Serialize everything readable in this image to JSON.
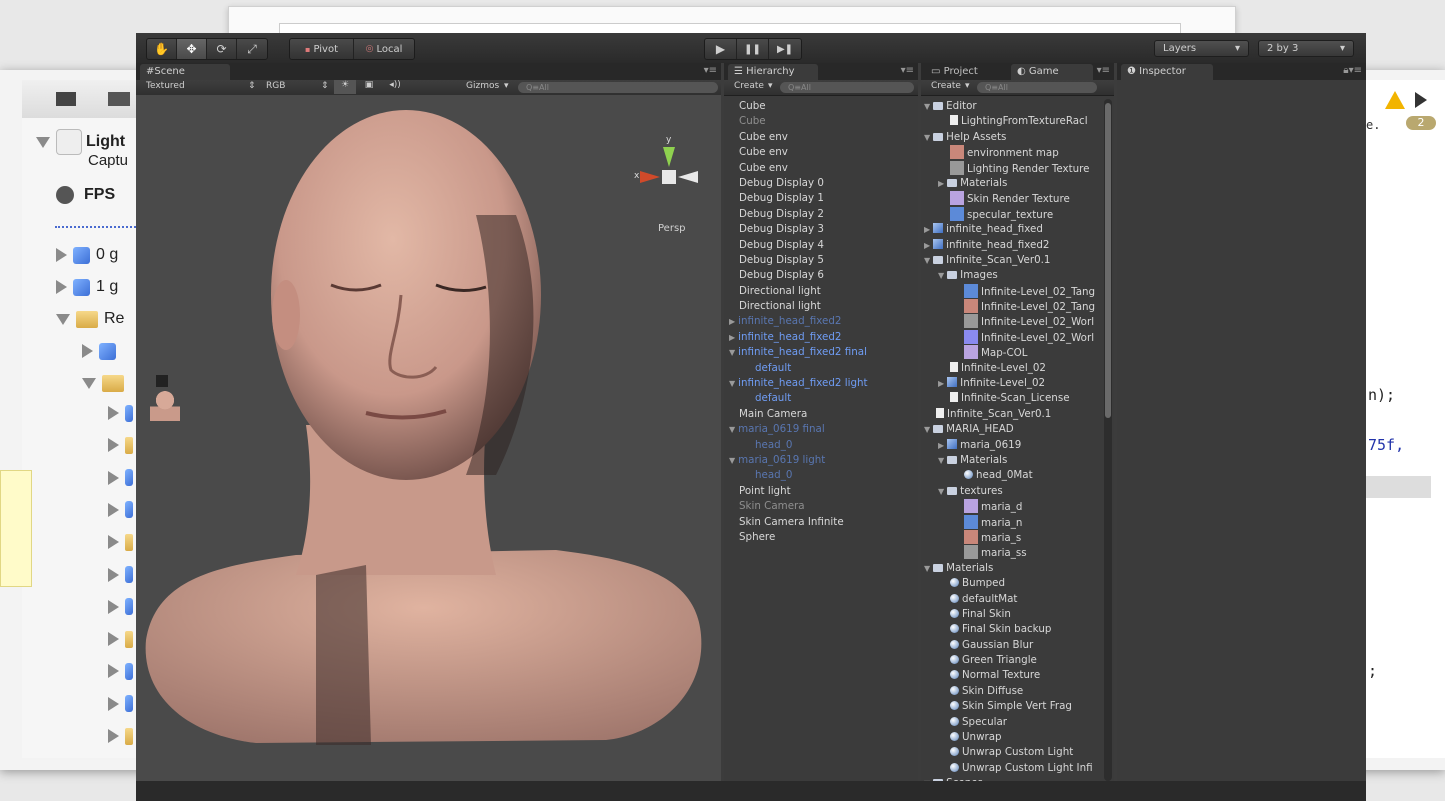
{
  "background_window": {
    "tree": [
      {
        "label": "Light",
        "sub": "Captu"
      },
      {
        "label": "FPS"
      },
      {
        "label": "0 g"
      },
      {
        "label": "1 g"
      },
      {
        "label": "Re"
      }
    ],
    "code_fragments": [
      "n);",
      "75f,",
      ";"
    ],
    "badge": "2",
    "dot": "e."
  },
  "toolbar": {
    "tools": [
      "hand-tool",
      "move-tool",
      "rotate-tool",
      "scale-tool"
    ],
    "pivot_label": "Pivot",
    "local_label": "Local",
    "play": "▶",
    "pause": "❚❚",
    "step": "▶❚",
    "layers_label": "Layers",
    "layout_label": "2 by 3"
  },
  "scene": {
    "tab": "Scene",
    "render_mode": "Textured",
    "channel": "RGB",
    "gizmos": "Gizmos",
    "search_placeholder": "Q≡All",
    "persp": "Persp",
    "gizmo_y": "y",
    "gizmo_x": "x"
  },
  "hierarchy": {
    "tab": "Hierarchy",
    "create": "Create",
    "search_placeholder": "Q≡All",
    "items": [
      {
        "label": "Cube",
        "style": "normal",
        "indent": 0,
        "arrow": ""
      },
      {
        "label": "Cube",
        "style": "dim",
        "indent": 0,
        "arrow": ""
      },
      {
        "label": "Cube env",
        "style": "normal",
        "indent": 0,
        "arrow": ""
      },
      {
        "label": "Cube env",
        "style": "normal",
        "indent": 0,
        "arrow": ""
      },
      {
        "label": "Cube env",
        "style": "normal",
        "indent": 0,
        "arrow": ""
      },
      {
        "label": "Debug Display 0",
        "style": "normal",
        "indent": 0,
        "arrow": ""
      },
      {
        "label": "Debug Display 1",
        "style": "normal",
        "indent": 0,
        "arrow": ""
      },
      {
        "label": "Debug Display 2",
        "style": "normal",
        "indent": 0,
        "arrow": ""
      },
      {
        "label": "Debug Display 3",
        "style": "normal",
        "indent": 0,
        "arrow": ""
      },
      {
        "label": "Debug Display 4",
        "style": "normal",
        "indent": 0,
        "arrow": ""
      },
      {
        "label": "Debug Display 5",
        "style": "normal",
        "indent": 0,
        "arrow": ""
      },
      {
        "label": "Debug Display 6",
        "style": "normal",
        "indent": 0,
        "arrow": ""
      },
      {
        "label": "Directional light",
        "style": "normal",
        "indent": 0,
        "arrow": ""
      },
      {
        "label": "Directional light",
        "style": "normal",
        "indent": 0,
        "arrow": ""
      },
      {
        "label": "infinite_head_fixed2",
        "style": "bluedim",
        "indent": 0,
        "arrow": "▶"
      },
      {
        "label": "infinite_head_fixed2",
        "style": "blue",
        "indent": 0,
        "arrow": "▶"
      },
      {
        "label": "infinite_head_fixed2 final",
        "style": "blue",
        "indent": 0,
        "arrow": "▼"
      },
      {
        "label": "default",
        "style": "blue",
        "indent": 1,
        "arrow": ""
      },
      {
        "label": "infinite_head_fixed2 light",
        "style": "blue",
        "indent": 0,
        "arrow": "▼"
      },
      {
        "label": "default",
        "style": "blue",
        "indent": 1,
        "arrow": ""
      },
      {
        "label": "Main Camera",
        "style": "normal",
        "indent": 0,
        "arrow": ""
      },
      {
        "label": "maria_0619 final",
        "style": "bluedim",
        "indent": 0,
        "arrow": "▼"
      },
      {
        "label": "head_0",
        "style": "bluedim",
        "indent": 1,
        "arrow": ""
      },
      {
        "label": "maria_0619 light",
        "style": "bluedim",
        "indent": 0,
        "arrow": "▼"
      },
      {
        "label": "head_0",
        "style": "bluedim",
        "indent": 1,
        "arrow": ""
      },
      {
        "label": "Point light",
        "style": "normal",
        "indent": 0,
        "arrow": ""
      },
      {
        "label": "Skin Camera",
        "style": "dim",
        "indent": 0,
        "arrow": ""
      },
      {
        "label": "Skin Camera Infinite",
        "style": "normal",
        "indent": 0,
        "arrow": ""
      },
      {
        "label": "Sphere",
        "style": "normal",
        "indent": 0,
        "arrow": ""
      }
    ]
  },
  "project": {
    "tab_project": "Project",
    "tab_game": "Game",
    "create": "Create",
    "search_placeholder": "Q≡All",
    "items": [
      {
        "label": "Editor",
        "indent": 0,
        "arrow": "▼",
        "icon": "folder"
      },
      {
        "label": "LightingFromTextureRacl",
        "indent": 1,
        "arrow": "",
        "icon": "doc"
      },
      {
        "label": "Help Assets",
        "indent": 0,
        "arrow": "▼",
        "icon": "folder"
      },
      {
        "label": "environment map",
        "indent": 1,
        "arrow": "",
        "icon": "tex"
      },
      {
        "label": "Lighting Render Texture",
        "indent": 1,
        "arrow": "",
        "icon": "tex"
      },
      {
        "label": "Materials",
        "indent": 1,
        "arrow": "▶",
        "icon": "folder"
      },
      {
        "label": "Skin Render Texture",
        "indent": 1,
        "arrow": "",
        "icon": "tex"
      },
      {
        "label": "specular_texture",
        "indent": 1,
        "arrow": "",
        "icon": "tex"
      },
      {
        "label": "infinite_head_fixed",
        "indent": 0,
        "arrow": "▶",
        "icon": "prefab"
      },
      {
        "label": "infinite_head_fixed2",
        "indent": 0,
        "arrow": "▶",
        "icon": "prefab"
      },
      {
        "label": "Infinite_Scan_Ver0.1",
        "indent": 0,
        "arrow": "▼",
        "icon": "folder"
      },
      {
        "label": "Images",
        "indent": 1,
        "arrow": "▼",
        "icon": "folder"
      },
      {
        "label": "Infinite-Level_02_Tang",
        "indent": 2,
        "arrow": "",
        "icon": "tex"
      },
      {
        "label": "Infinite-Level_02_Tang",
        "indent": 2,
        "arrow": "",
        "icon": "tex"
      },
      {
        "label": "Infinite-Level_02_Worl",
        "indent": 2,
        "arrow": "",
        "icon": "tex"
      },
      {
        "label": "Infinite-Level_02_Worl",
        "indent": 2,
        "arrow": "",
        "icon": "tex"
      },
      {
        "label": "Map-COL",
        "indent": 2,
        "arrow": "",
        "icon": "tex"
      },
      {
        "label": "Infinite-Level_02",
        "indent": 1,
        "arrow": "",
        "icon": "doc"
      },
      {
        "label": "Infinite-Level_02",
        "indent": 1,
        "arrow": "▶",
        "icon": "prefab"
      },
      {
        "label": "Infinite-Scan_License",
        "indent": 1,
        "arrow": "",
        "icon": "doc"
      },
      {
        "label": "Infinite_Scan_Ver0.1",
        "indent": 0,
        "arrow": "",
        "icon": "doc"
      },
      {
        "label": "MARIA_HEAD",
        "indent": 0,
        "arrow": "▼",
        "icon": "folder"
      },
      {
        "label": "maria_0619",
        "indent": 1,
        "arrow": "▶",
        "icon": "prefab"
      },
      {
        "label": "Materials",
        "indent": 1,
        "arrow": "▼",
        "icon": "folder"
      },
      {
        "label": "head_0Mat",
        "indent": 2,
        "arrow": "",
        "icon": "ball"
      },
      {
        "label": "textures",
        "indent": 1,
        "arrow": "▼",
        "icon": "folder"
      },
      {
        "label": "maria_d",
        "indent": 2,
        "arrow": "",
        "icon": "tex"
      },
      {
        "label": "maria_n",
        "indent": 2,
        "arrow": "",
        "icon": "tex"
      },
      {
        "label": "maria_s",
        "indent": 2,
        "arrow": "",
        "icon": "tex"
      },
      {
        "label": "maria_ss",
        "indent": 2,
        "arrow": "",
        "icon": "tex"
      },
      {
        "label": "Materials",
        "indent": 0,
        "arrow": "▼",
        "icon": "folder"
      },
      {
        "label": "Bumped",
        "indent": 1,
        "arrow": "",
        "icon": "ball"
      },
      {
        "label": "defaultMat",
        "indent": 1,
        "arrow": "",
        "icon": "ball"
      },
      {
        "label": "Final Skin",
        "indent": 1,
        "arrow": "",
        "icon": "ball"
      },
      {
        "label": "Final Skin backup",
        "indent": 1,
        "arrow": "",
        "icon": "ball"
      },
      {
        "label": "Gaussian Blur",
        "indent": 1,
        "arrow": "",
        "icon": "ball"
      },
      {
        "label": "Green Triangle",
        "indent": 1,
        "arrow": "",
        "icon": "ball"
      },
      {
        "label": "Normal Texture",
        "indent": 1,
        "arrow": "",
        "icon": "ball"
      },
      {
        "label": "Skin Diffuse",
        "indent": 1,
        "arrow": "",
        "icon": "ball"
      },
      {
        "label": "Skin Simple Vert Frag",
        "indent": 1,
        "arrow": "",
        "icon": "ball"
      },
      {
        "label": "Specular",
        "indent": 1,
        "arrow": "",
        "icon": "ball"
      },
      {
        "label": "Unwrap",
        "indent": 1,
        "arrow": "",
        "icon": "ball"
      },
      {
        "label": "Unwrap Custom Light",
        "indent": 1,
        "arrow": "",
        "icon": "ball"
      },
      {
        "label": "Unwrap Custom Light Infi",
        "indent": 1,
        "arrow": "",
        "icon": "ball"
      },
      {
        "label": "Scenes",
        "indent": 0,
        "arrow": "▼",
        "icon": "folder"
      }
    ]
  },
  "inspector": {
    "tab": "Inspector"
  },
  "colors": {
    "unity_bg": "#3c3c3c",
    "selection_blue": "#6f9cf3",
    "skin": "#d8a998"
  }
}
